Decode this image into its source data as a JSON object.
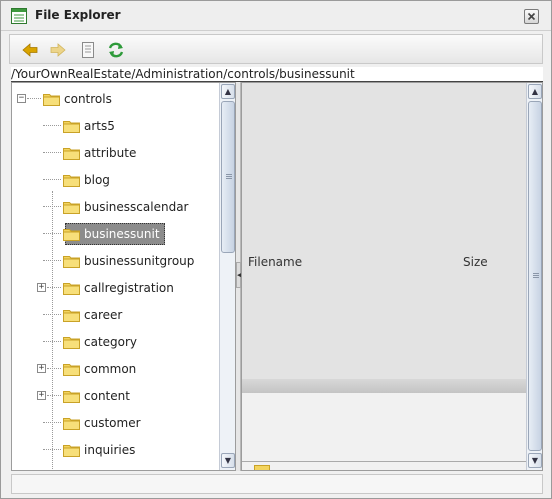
{
  "window": {
    "title": "File Explorer",
    "app_icon": "window-list-icon",
    "close_icon": "close-icon"
  },
  "toolbar": {
    "buttons": [
      {
        "name": "back-button",
        "icon": "arrow-left-icon",
        "color": "#d4a000"
      },
      {
        "name": "forward-button",
        "icon": "arrow-right-icon",
        "color": "#e8c96a"
      },
      {
        "name": "properties-button",
        "icon": "document-icon"
      },
      {
        "name": "refresh-button",
        "icon": "refresh-icon",
        "color": "#2e9a3a"
      }
    ]
  },
  "path": "/YourOwnRealEstate/Administration/controls/businessunit",
  "tree": {
    "root": {
      "label": "controls",
      "expanded": true
    },
    "items": [
      {
        "label": "arts5",
        "expandable": false
      },
      {
        "label": "attribute",
        "expandable": false
      },
      {
        "label": "blog",
        "expandable": false
      },
      {
        "label": "businesscalendar",
        "expandable": false
      },
      {
        "label": "businessunit",
        "expandable": false,
        "selected": true
      },
      {
        "label": "businessunitgroup",
        "expandable": false
      },
      {
        "label": "callregistration",
        "expandable": true
      },
      {
        "label": "career",
        "expandable": false
      },
      {
        "label": "category",
        "expandable": false
      },
      {
        "label": "common",
        "expandable": true
      },
      {
        "label": "content",
        "expandable": true
      },
      {
        "label": "customer",
        "expandable": false
      },
      {
        "label": "inquiries",
        "expandable": false
      }
    ]
  },
  "list": {
    "columns": {
      "filename": "Filename",
      "size": "Size"
    }
  },
  "colors": {
    "folder": "#f3d45e",
    "folder_dark": "#c9a227",
    "selection": "#8c8c8c",
    "scrollbar": "#c7d3e3"
  }
}
